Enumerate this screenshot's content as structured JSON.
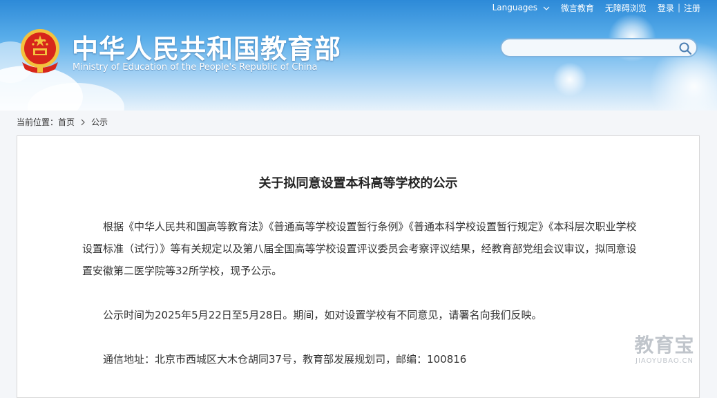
{
  "topbar": {
    "languages": "Languages",
    "wechat": "微言教育",
    "accessible": "无障碍浏览",
    "login": "登录",
    "register": "注册"
  },
  "brand": {
    "title_cn": "中华人民共和国教育部",
    "title_en": "Ministry of Education of the People's Republic of China"
  },
  "search": {
    "placeholder": "",
    "value": ""
  },
  "breadcrumb": {
    "prefix": "当前位置：",
    "home": "首页",
    "current": "公示"
  },
  "article": {
    "title": "关于拟同意设置本科高等学校的公示",
    "paragraphs": [
      "根据《中华人民共和国高等教育法》《普通高等学校设置暂行条例》《普通本科学校设置暂行规定》《本科层次职业学校设置标准（试行）》等有关规定以及第八届全国高等学校设置评议委员会考察评议结果，经教育部党组会议审议，拟同意设置安徽第二医学院等32所学校，现予公示。",
      "公示时间为2025年5月22日至5月28日。期间，如对设置学校有不同意见，请署名向我们反映。",
      "通信地址：北京市西城区大木仓胡同37号，教育部发展规划司，邮编：100816"
    ]
  },
  "watermark": {
    "cn": "教育宝",
    "en": "JIAOYUBAO.CN"
  },
  "colors": {
    "sky_top": "#2d8ad8",
    "emblem_red": "#d7261b",
    "emblem_gold": "#f3c23d",
    "text": "#333333"
  },
  "icons": [
    "chevron-down-icon",
    "search-icon",
    "chevron-right-icon",
    "national-emblem-icon"
  ]
}
